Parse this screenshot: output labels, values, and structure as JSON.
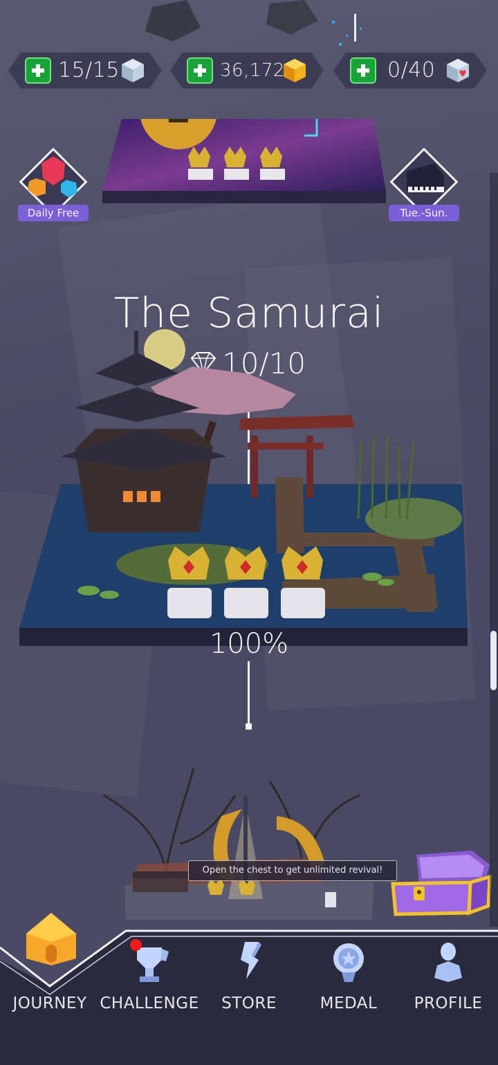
{
  "currency": {
    "lives": "15/15",
    "coins": "36,172",
    "hearts": "0/40"
  },
  "badges": {
    "daily": "Daily Free",
    "weekly": "Tue.-Sun."
  },
  "level": {
    "title": "The Samurai",
    "gems": "10/10",
    "progress": "100%",
    "crowns_earned": 3
  },
  "tooltip": "Open the chest to get unlimited revival!",
  "nav": {
    "journey": "JOURNEY",
    "challenge": "CHALLENGE",
    "store": "STORE",
    "medal": "MEDAL",
    "profile": "PROFILE"
  },
  "colors": {
    "accent_purple": "#7b5fd6",
    "plus_green": "#1aa33a",
    "coin_gold": "#f3b21c",
    "notification_red": "#f01b1b"
  }
}
